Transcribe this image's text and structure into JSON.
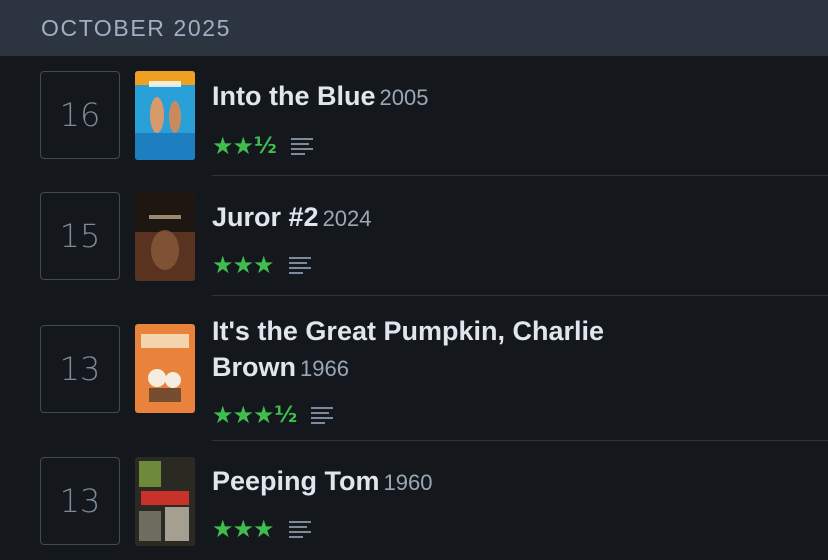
{
  "month_header": "OCTOBER 2025",
  "entries": [
    {
      "day": "16",
      "title": "Into the Blue",
      "year": "2005",
      "stars": "★★",
      "half": "½",
      "poster_icon": "poster-into-the-blue"
    },
    {
      "day": "15",
      "title": "Juror #2",
      "year": "2024",
      "stars": "★★★",
      "half": "",
      "poster_icon": "poster-juror-2"
    },
    {
      "day": "13",
      "title_line1": "It's the Great Pumpkin, Charlie",
      "title_line2": "Brown",
      "year": "1966",
      "stars": "★★★",
      "half": "½",
      "poster_icon": "poster-great-pumpkin"
    },
    {
      "day": "13",
      "title": "Peeping Tom",
      "year": "1960",
      "stars": "★★★",
      "half": "",
      "poster_icon": "poster-peeping-tom"
    }
  ],
  "colors": {
    "background": "#14181c",
    "header": "#2c3440",
    "star": "#40bd4f",
    "title": "#dfe6ee",
    "muted": "#9aa7b5"
  }
}
